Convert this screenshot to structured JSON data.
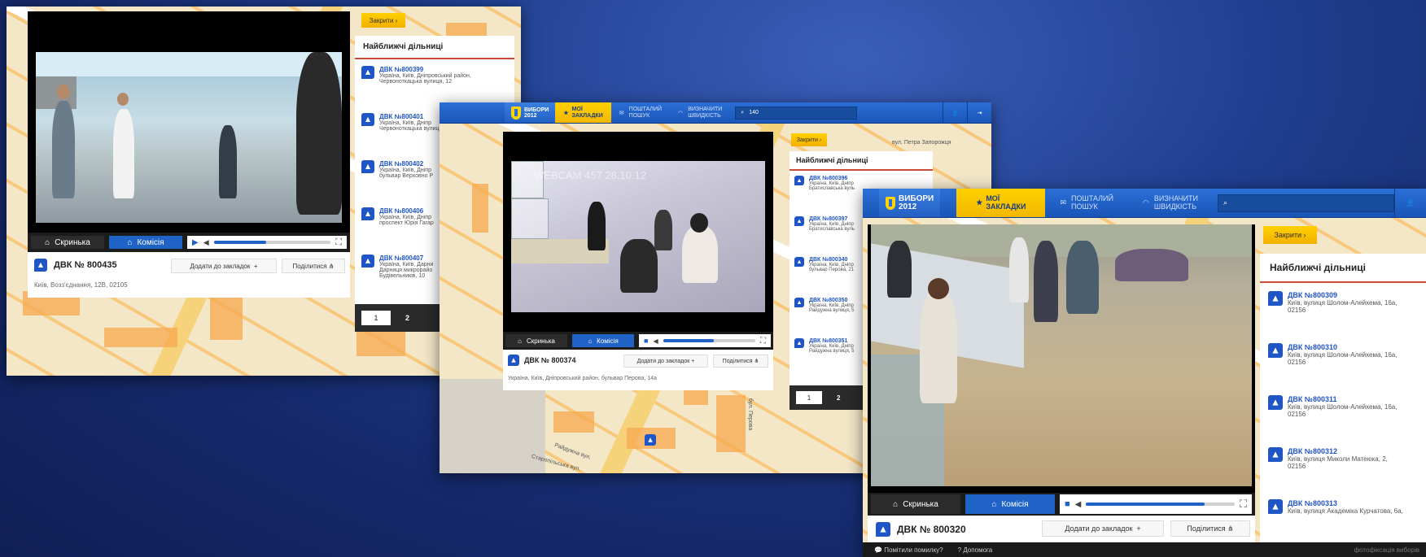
{
  "brand": {
    "logo_line1": "ВИБОРИ",
    "logo_line2": "2012"
  },
  "topbar": {
    "favorites_label": "МОЇ ЗАКЛАДКИ",
    "fav_line1": "МОЇ",
    "fav_line2": "ЗАКЛАДКИ",
    "postal_line1": "ПОШТАЛИЙ",
    "postal_line2": "ПОШУК",
    "speed_line1": "ВИЗНАЧИТИ",
    "speed_line2": "ШВИДКІСТЬ",
    "search_value": "140"
  },
  "close_label": "Закрити",
  "nearest_title": "Найближчі дільниці",
  "shot1": {
    "tabs": {
      "box": "Скринька",
      "commission": "Комісія"
    },
    "dvk": "ДВК № 800435",
    "address": "Київ, Возз'єднання, 12В, 02105",
    "bookmark": "Додати до закладок",
    "share": "Поділитися",
    "list": [
      {
        "title": "ДВК №800399",
        "lines": [
          "Україна, Київ, Дніпровський район,",
          "Червоноткацька вулиця, 12"
        ]
      },
      {
        "title": "ДВК №800401",
        "lines": [
          "Україна, Київ, Дніпр",
          "Червоноткацька вулиц"
        ]
      },
      {
        "title": "ДВК №800402",
        "lines": [
          "Україна, Київ, Дніпр",
          "бульвар Верховно Р"
        ]
      },
      {
        "title": "ДВК №800406",
        "lines": [
          "Україна, Київ, Дніпр",
          "проспект Юрія Гагар"
        ]
      },
      {
        "title": "ДВК №800407",
        "lines": [
          "Україна, Київ, Дарни",
          "Дарниця микрорайо",
          "Будівельників, 10"
        ]
      }
    ],
    "pages": [
      "1",
      "2"
    ]
  },
  "shot2": {
    "watermark": "WEBCAM 457 28.10.12",
    "tabs": {
      "box": "Скринька",
      "commission": "Комісія"
    },
    "dvk": "ДВК № 800374",
    "address": "Україна, Київ, Дніпровський район, бульвар Перова, 14а",
    "bookmark": "Додати до закладок",
    "share": "Поділитися",
    "street_1": "вул. Петра Запорожця",
    "street_2": "Райдужна вул.",
    "street_3": "бул. Перова",
    "street_4": "Старопільська вул.",
    "list": [
      {
        "title": "ДВК №800396",
        "lines": [
          "Україна, Київ, Дніпр",
          "Братиславська вуль"
        ]
      },
      {
        "title": "ДВК №800397",
        "lines": [
          "Україна, Київ, Дніпр",
          "Братиславська вуль"
        ]
      },
      {
        "title": "ДВК №800340",
        "lines": [
          "Україна, Київ, Дніпр",
          "бульвар Перова, 21"
        ]
      },
      {
        "title": "ДВК №800350",
        "lines": [
          "Україна, Київ, Дніпр",
          "Райдужна вулиця, 5"
        ]
      },
      {
        "title": "ДВК №800351",
        "lines": [
          "Україна, Київ, Дніпр",
          "Райдужна вулиця, 5"
        ]
      }
    ],
    "pages": [
      "1",
      "2"
    ]
  },
  "shot3": {
    "tabs": {
      "box": "Скринька",
      "commission": "Комісія"
    },
    "dvk": "ДВК № 800320",
    "bookmark": "Додати до закладок",
    "share": "Поділитися",
    "list": [
      {
        "title": "ДВК №800309",
        "lines": [
          "Київ, вулиця Шолом-Алейхема, 16а,",
          "02156"
        ]
      },
      {
        "title": "ДВК №800310",
        "lines": [
          "Київ, вулиця Шолом-Алейхема, 16а,",
          "02156"
        ]
      },
      {
        "title": "ДВК №800311",
        "lines": [
          "Київ, вулиця Шолом-Алейхема, 16а,",
          "02156"
        ]
      },
      {
        "title": "ДВК №800312",
        "lines": [
          "Київ, вулиця Миколи Матеюка, 2,",
          "02156"
        ]
      },
      {
        "title": "ДВК №800313",
        "lines": [
          "Київ, вулиця Академіка Курчатова, 6а,"
        ]
      }
    ],
    "footer": {
      "report": "Помітили помилку?",
      "help": "Допомога",
      "credit": "фотофіксація виборів"
    }
  }
}
